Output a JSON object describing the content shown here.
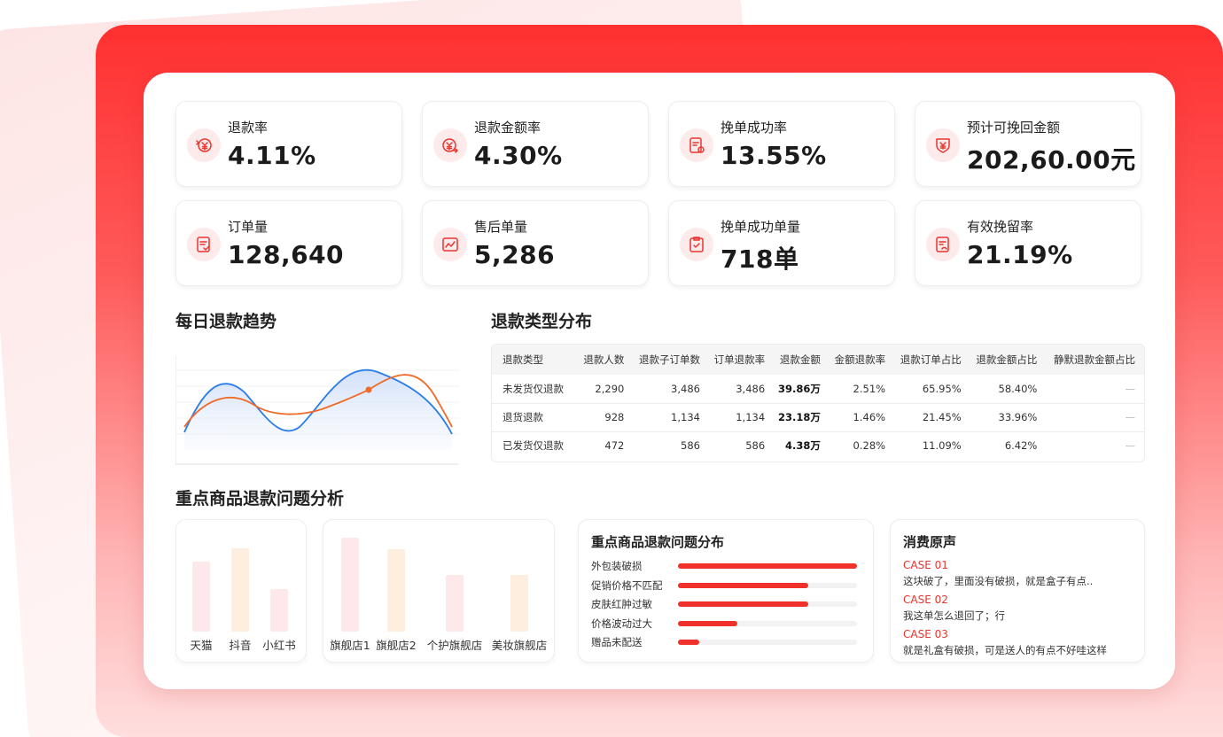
{
  "colors": {
    "accent": "#f0302a",
    "frame": "#ff3333",
    "line_blue": "#2b7de9",
    "line_orange": "#f06a2a"
  },
  "kpis": [
    {
      "label": "退款率",
      "value": "4.11%",
      "icon": "refund-rate-icon"
    },
    {
      "label": "退款金额率",
      "value": "4.30%",
      "icon": "refund-amount-icon"
    },
    {
      "label": "挽单成功率",
      "value": "13.55%",
      "icon": "save-success-icon"
    },
    {
      "label": "预计可挽回金额",
      "value": "202,60.00元",
      "icon": "shield-yen-icon"
    },
    {
      "label": "订单量",
      "value": "128,640",
      "icon": "order-icon"
    },
    {
      "label": "售后单量",
      "value": "5,286",
      "icon": "after-sale-icon"
    },
    {
      "label": "挽单成功单量",
      "value": "718单",
      "icon": "clipboard-check-icon"
    },
    {
      "label": "有效挽留率",
      "value": "21.19%",
      "icon": "retention-icon"
    }
  ],
  "trend": {
    "title": "每日退款趋势"
  },
  "refund_table": {
    "title": "退款类型分布",
    "headers": [
      "退款类型",
      "退款人数",
      "退款子订单数",
      "订单退款率",
      "退款金额",
      "金额退款率",
      "退款订单占比",
      "退款金额占比",
      "静默退款金额占比"
    ],
    "rows": [
      [
        "未发货仅退款",
        "2,290",
        "3,486",
        "3,486",
        "39.86万",
        "2.51%",
        "65.95%",
        "58.40%",
        "—"
      ],
      [
        "退货退款",
        "928",
        "1,134",
        "1,134",
        "23.18万",
        "1.46%",
        "21.45%",
        "33.96%",
        "—"
      ],
      [
        "已发货仅退款",
        "472",
        "586",
        "586",
        "4.38万",
        "0.28%",
        "11.09%",
        "6.42%",
        "—"
      ]
    ]
  },
  "key_products": {
    "title": "重点商品退款问题分析"
  },
  "platforms": {
    "labels": [
      "天猫",
      "抖音",
      "小红书"
    ],
    "values": [
      0.79,
      0.94,
      0.48
    ]
  },
  "stores": {
    "labels": [
      "旗舰店1",
      "旗舰店2",
      "个护旗舰店",
      "美妆旗舰店"
    ],
    "values": [
      1.0,
      0.88,
      0.6,
      0.6
    ]
  },
  "issues": {
    "title": "重点商品退款问题分布",
    "items": [
      {
        "label": "外包装破损",
        "value": 1.0
      },
      {
        "label": "促销价格不匹配",
        "value": 0.73
      },
      {
        "label": "皮肤红肿过敏",
        "value": 0.73
      },
      {
        "label": "价格波动过大",
        "value": 0.33
      },
      {
        "label": "赠品未配送",
        "value": 0.12
      }
    ]
  },
  "voices": {
    "title": "消费原声",
    "cases": [
      {
        "id": "CASE 01",
        "text": "这块破了，里面没有破损，就是盒子有点.."
      },
      {
        "id": "CASE 02",
        "text": "我这单怎么退回了；行"
      },
      {
        "id": "CASE 03",
        "text": "就是礼盒有破损，可是送人的有点不好哇这样"
      }
    ]
  }
}
